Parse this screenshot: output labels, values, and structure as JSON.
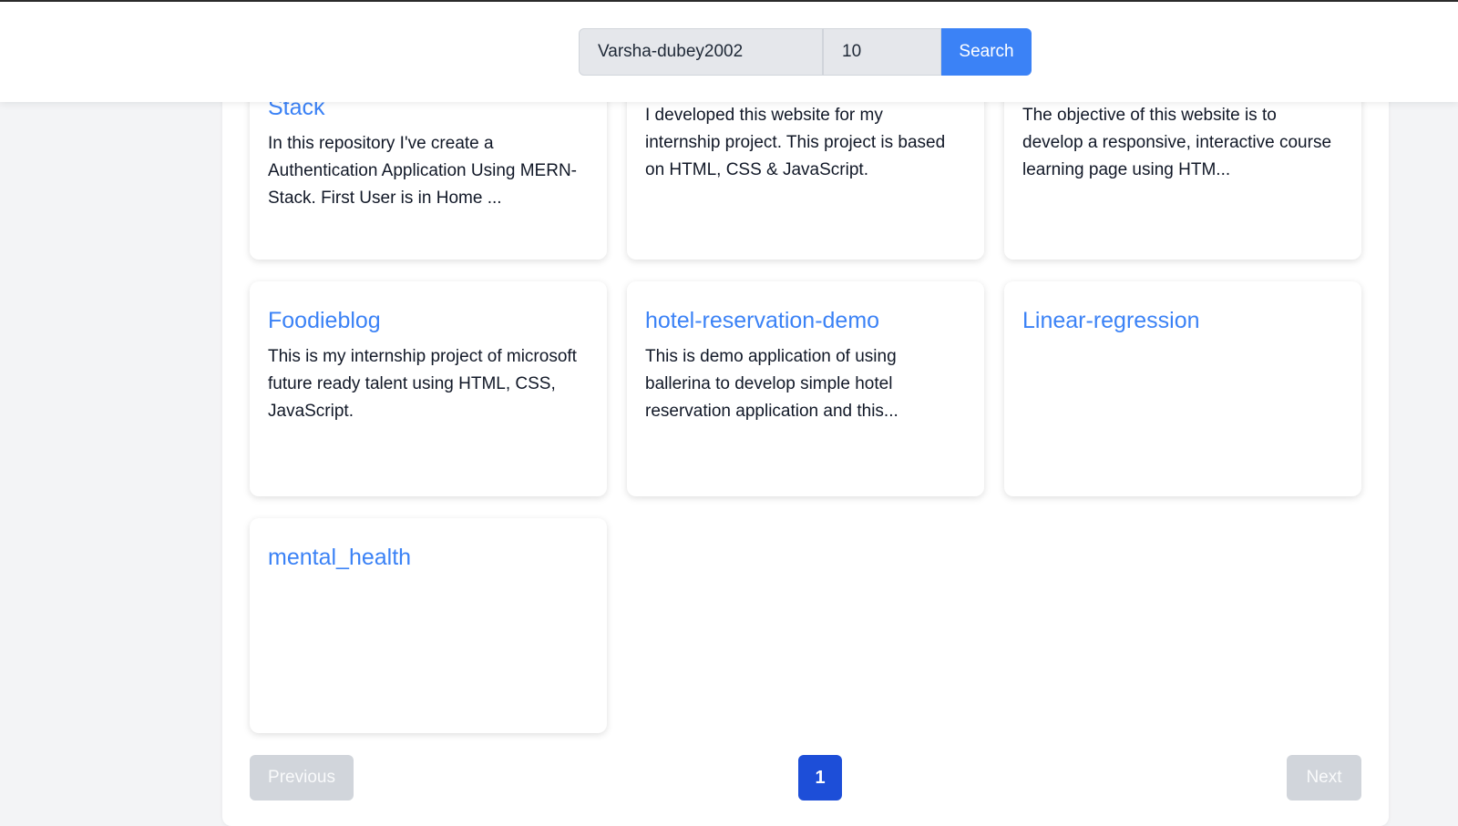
{
  "search": {
    "username_value": "Varsha-dubey2002",
    "count_value": "10",
    "button_label": "Search"
  },
  "repos": [
    {
      "title": "Stack",
      "description": "In this repository I've create a Authentication Application Using MERN-Stack. First User is in Home ..."
    },
    {
      "title": "",
      "description": "I developed this website for my internship project. This project is based on HTML, CSS & JavaScript."
    },
    {
      "title": "",
      "description": "The objective of this website is to develop a responsive, interactive course learning page using HTM..."
    },
    {
      "title": "Foodieblog",
      "description": "This is my internship project of microsoft future ready talent using HTML, CSS, JavaScript."
    },
    {
      "title": "hotel-reservation-demo",
      "description": "This is demo application of using ballerina to develop simple hotel reservation application and this..."
    },
    {
      "title": "Linear-regression",
      "description": ""
    },
    {
      "title": "mental_health",
      "description": ""
    }
  ],
  "pagination": {
    "previous_label": "Previous",
    "current_page": "1",
    "next_label": "Next"
  },
  "colors": {
    "accent": "#3b82f6",
    "active_page": "#1d4ed8",
    "disabled": "#d1d5db"
  }
}
